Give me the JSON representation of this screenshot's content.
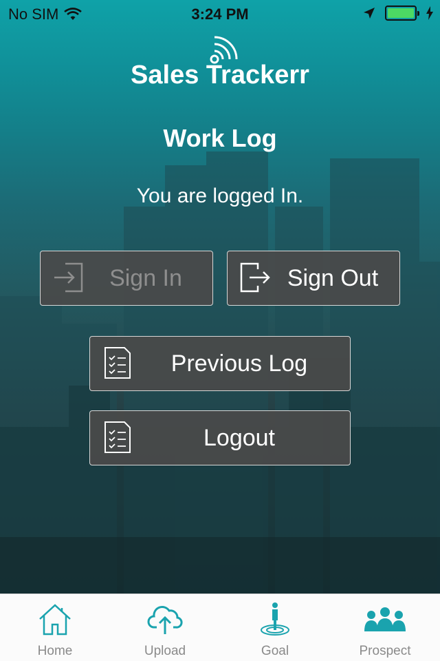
{
  "status_bar": {
    "carrier": "No SIM",
    "time": "3:24 PM"
  },
  "header": {
    "app_name": "Sales Trackerr",
    "screen_title": "Work Log",
    "status_message": "You are logged In."
  },
  "actions": {
    "sign_in": {
      "label": "Sign In",
      "icon": "sign-in-icon",
      "enabled": false
    },
    "sign_out": {
      "label": "Sign Out",
      "icon": "sign-out-icon",
      "enabled": true
    },
    "previous_log": {
      "label": "Previous Log",
      "icon": "checklist-icon",
      "enabled": true
    },
    "logout": {
      "label": "Logout",
      "icon": "checklist-icon",
      "enabled": true
    }
  },
  "tab_bar": {
    "tabs": [
      {
        "label": "Home",
        "icon": "home-icon"
      },
      {
        "label": "Upload",
        "icon": "cloud-upload-icon"
      },
      {
        "label": "Goal",
        "icon": "goal-icon"
      },
      {
        "label": "Prospect",
        "icon": "prospect-group-icon"
      }
    ]
  },
  "colors": {
    "accent": "#1aa3ae",
    "button_bg": "#4a4a4a",
    "battery": "#4cd964"
  }
}
